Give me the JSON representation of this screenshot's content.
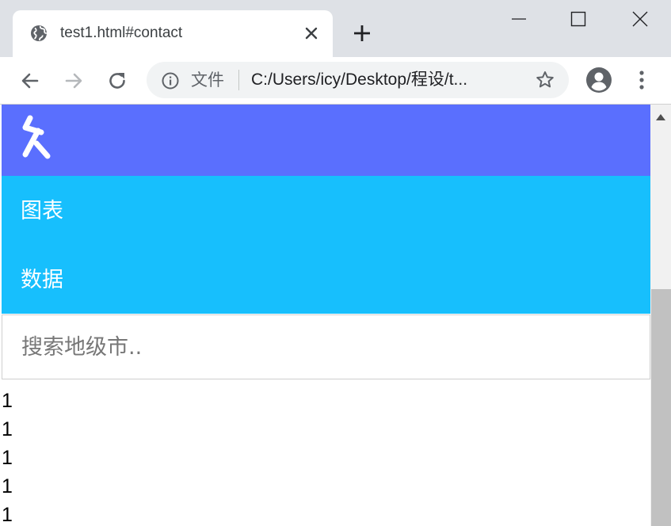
{
  "browser": {
    "tab_title": "test1.html#contact",
    "site_label": "文件",
    "url": "C:/Users/icy/Desktop/程设/t..."
  },
  "page": {
    "menu_items": [
      "图表",
      "数据"
    ],
    "search_placeholder": "搜索地级市..",
    "results": [
      "1",
      "1",
      "1",
      "1",
      "1"
    ]
  },
  "colors": {
    "brand_bar": "#5a6ffe",
    "menu_bg": "#17bffd"
  }
}
